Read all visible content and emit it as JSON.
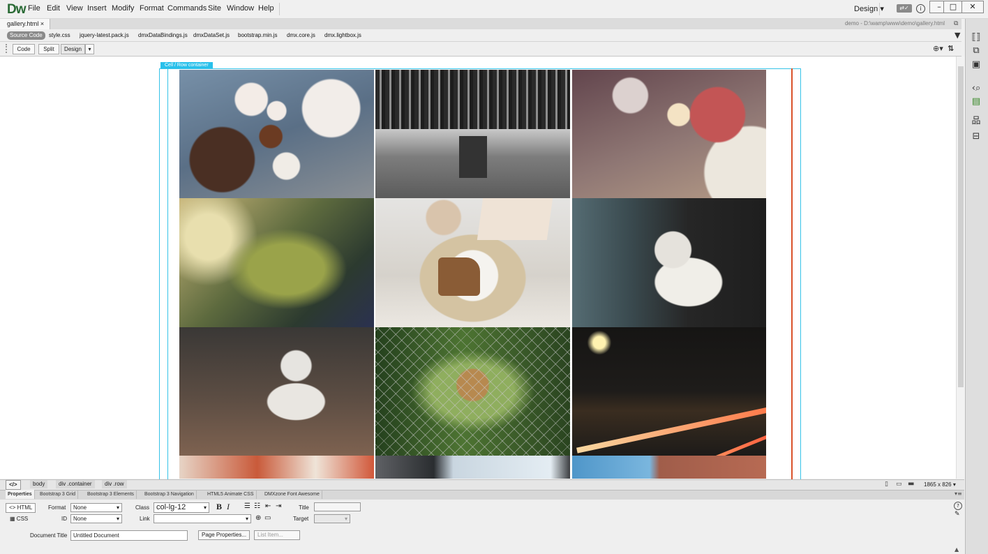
{
  "app": {
    "logo": "Dw",
    "workspace": "Design"
  },
  "menu": [
    "File",
    "Edit",
    "View",
    "Insert",
    "Modify",
    "Format",
    "Commands",
    "Site",
    "Window",
    "Help"
  ],
  "window_controls": {
    "minimize": "–",
    "maximize": "□",
    "close": "✕"
  },
  "document": {
    "tab_label": "gallery.html",
    "tab_close": "×",
    "path": "demo - D:\\wamp\\www\\demo\\gallery.html"
  },
  "related_files": {
    "source_code": "Source Code",
    "files": [
      "style.css",
      "jquery-latest.pack.js",
      "dmxDataBindings.js",
      "dmxDataSet.js",
      "bootstrap.min.js",
      "dmx.core.js",
      "dmx.lightbox.js"
    ]
  },
  "view_buttons": {
    "code": "Code",
    "split": "Split",
    "design": "Design"
  },
  "canvas": {
    "cell_tag": "Cell / Row",
    "cell_tag_suffix": "container"
  },
  "gallery_photos": [
    "food-cake-plates",
    "bridge-underside-bw",
    "christmas-table",
    "moss-closeup",
    "coffee-cake-book",
    "cat-at-window",
    "kitten-sitting",
    "dog-behind-fence",
    "highway-night-lights",
    "partial-bottom-1",
    "partial-bottom-2",
    "partial-bottom-3"
  ],
  "tag_selector": {
    "code_icon": "</>",
    "crumbs": [
      "body",
      "div .container",
      "div .row"
    ],
    "window_size": "1865 x 826 ▾"
  },
  "properties": {
    "tabs": [
      "Properties",
      "Bootstrap 3 Grid",
      "Bootstrap 3 Elements",
      "Bootstrap 3 Navigation",
      "HTML5 Animate CSS",
      "DMXzone Font Awesome"
    ],
    "html_btn": "<> HTML",
    "css_btn": "CSS",
    "format_label": "Format",
    "format_value": "None",
    "class_label": "Class",
    "class_value": "col-lg-12",
    "id_label": "ID",
    "id_value": "None",
    "link_label": "Link",
    "link_value": "",
    "title_label": "Title",
    "title_value": "",
    "target_label": "Target",
    "bold": "B",
    "italic": "I",
    "doc_title_label": "Document Title",
    "doc_title_value": "Untitled Document",
    "page_props_btn": "Page Properties...",
    "list_item_btn": "List Item..."
  }
}
